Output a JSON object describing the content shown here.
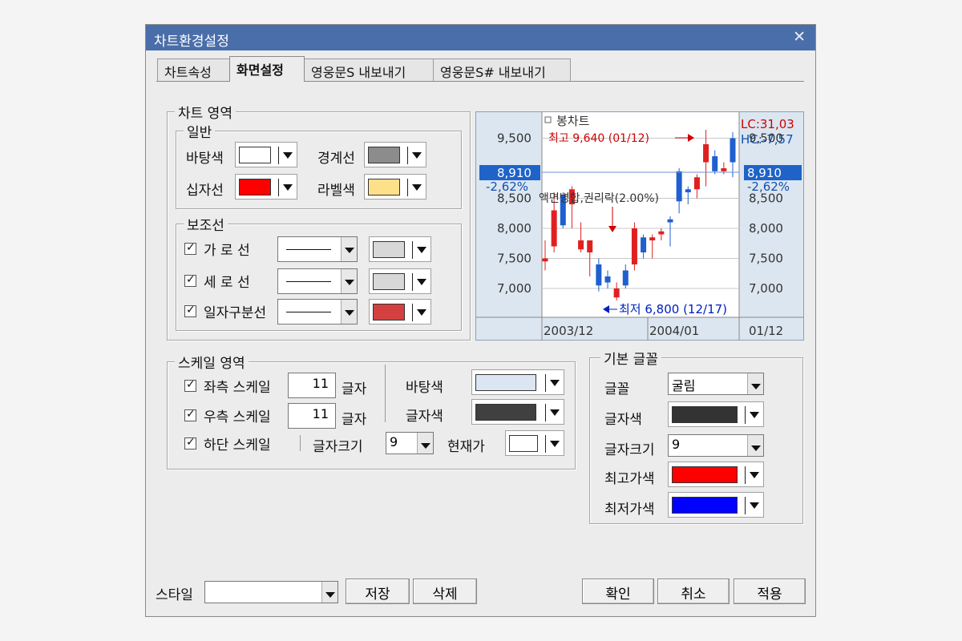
{
  "window": {
    "title": "차트환경설정",
    "close": "✕"
  },
  "tabs": [
    "차트속성",
    "화면설정",
    "영웅문S 내보내기",
    "영웅문S# 내보내기"
  ],
  "chart_area": {
    "legend": "차트 영역",
    "general": {
      "legend": "일반",
      "background": "바탕색",
      "border": "경계선",
      "crosshair": "십자선",
      "label": "라벨색",
      "colors": {
        "background": "#ffffff",
        "border": "#8c8c8c",
        "crosshair": "#ff0000",
        "label": "#ffe08a"
      }
    },
    "aux": {
      "legend": "보조선",
      "horizontal": "가 로 선",
      "vertical": "세 로 선",
      "date_divider": "일자구분선",
      "colors": {
        "horizontal": "#d8d8d8",
        "vertical": "#d8d8d8",
        "date_divider": "#d44040"
      }
    }
  },
  "preview": {
    "title": "봉차트",
    "high_label": "최고 9,640 (01/12)",
    "low_label": "최저 6,800 (12/17)",
    "event_label": "액면병합,권리락(2.00%)",
    "lc": "LC:31,03",
    "hc": "HC:-7,57",
    "current_left": "8,910",
    "current_right": "8,910",
    "pct_left": "-2,62%",
    "pct_right": "-2,62%",
    "y_ticks": [
      "9,500",
      "8,500",
      "8,000",
      "7,500",
      "7,000"
    ],
    "x_ticks": [
      "2003/12",
      "2004/01",
      "01/12"
    ]
  },
  "scale_area": {
    "legend": "스케일 영역",
    "left_scale": "좌측 스케일",
    "left_value": "11",
    "left_unit": "글자",
    "right_scale": "우측 스케일",
    "right_value": "11",
    "right_unit": "글자",
    "bottom_scale": "하단 스케일",
    "font_size_label": "글자크기",
    "font_size_value": "9",
    "background": "바탕색",
    "text_color": "글자색",
    "current_price": "현재가",
    "colors": {
      "background": "#dce6f2",
      "text_color": "#404040",
      "current_price": "#ffffff"
    }
  },
  "font_area": {
    "legend": "기본 글꼴",
    "font": "글꼴",
    "font_value": "굴림",
    "text_color": "글자색",
    "font_size": "글자크기",
    "font_size_value": "9",
    "high_color": "최고가색",
    "low_color": "최저가색",
    "colors": {
      "text_color": "#333333",
      "high_color": "#ff0000",
      "low_color": "#0000ff"
    }
  },
  "footer": {
    "style_label": "스타일",
    "style_value": "",
    "save": "저장",
    "delete": "삭제",
    "ok": "확인",
    "cancel": "취소",
    "apply": "적용"
  },
  "chart_data": {
    "type": "candlestick",
    "y_range": [
      6600,
      9800
    ],
    "candles": [
      {
        "o": 7500,
        "h": 7800,
        "l": 7300,
        "c": 7450,
        "up": true
      },
      {
        "o": 8300,
        "h": 8600,
        "l": 7600,
        "c": 7700,
        "up": true
      },
      {
        "o": 8560,
        "h": 8600,
        "l": 8000,
        "c": 8050,
        "up": false
      },
      {
        "o": 8400,
        "h": 8700,
        "l": 8000,
        "c": 8650,
        "up": true
      },
      {
        "o": 7800,
        "h": 8100,
        "l": 7600,
        "c": 7650,
        "up": true
      },
      {
        "o": 7600,
        "h": 7800,
        "l": 7200,
        "c": 7800,
        "up": true
      },
      {
        "o": 7400,
        "h": 7500,
        "l": 6950,
        "c": 7050,
        "up": false
      },
      {
        "o": 7200,
        "h": 7300,
        "l": 7000,
        "c": 7100,
        "up": false
      },
      {
        "o": 7000,
        "h": 7100,
        "l": 6800,
        "c": 6850,
        "up": true
      },
      {
        "o": 7300,
        "h": 7400,
        "l": 7000,
        "c": 7050,
        "up": false
      },
      {
        "o": 7400,
        "h": 8100,
        "l": 7300,
        "c": 8000,
        "up": true
      },
      {
        "o": 7600,
        "h": 7900,
        "l": 7500,
        "c": 7850,
        "up": false
      },
      {
        "o": 7800,
        "h": 7900,
        "l": 7500,
        "c": 7850,
        "up": true
      },
      {
        "o": 7950,
        "h": 8000,
        "l": 7800,
        "c": 7900,
        "up": true
      },
      {
        "o": 8100,
        "h": 8200,
        "l": 7700,
        "c": 8150,
        "up": false
      },
      {
        "o": 8450,
        "h": 9000,
        "l": 8250,
        "c": 8950,
        "up": false
      },
      {
        "o": 8650,
        "h": 8700,
        "l": 8400,
        "c": 8600,
        "up": false
      },
      {
        "o": 8850,
        "h": 8900,
        "l": 8500,
        "c": 8650,
        "up": true
      },
      {
        "o": 9100,
        "h": 9640,
        "l": 8700,
        "c": 9400,
        "up": true
      },
      {
        "o": 9200,
        "h": 9300,
        "l": 8900,
        "c": 8950,
        "up": false
      },
      {
        "o": 9000,
        "h": 9100,
        "l": 8900,
        "c": 8950,
        "up": true
      },
      {
        "o": 9100,
        "h": 9600,
        "l": 8850,
        "c": 9500,
        "up": false
      }
    ]
  }
}
